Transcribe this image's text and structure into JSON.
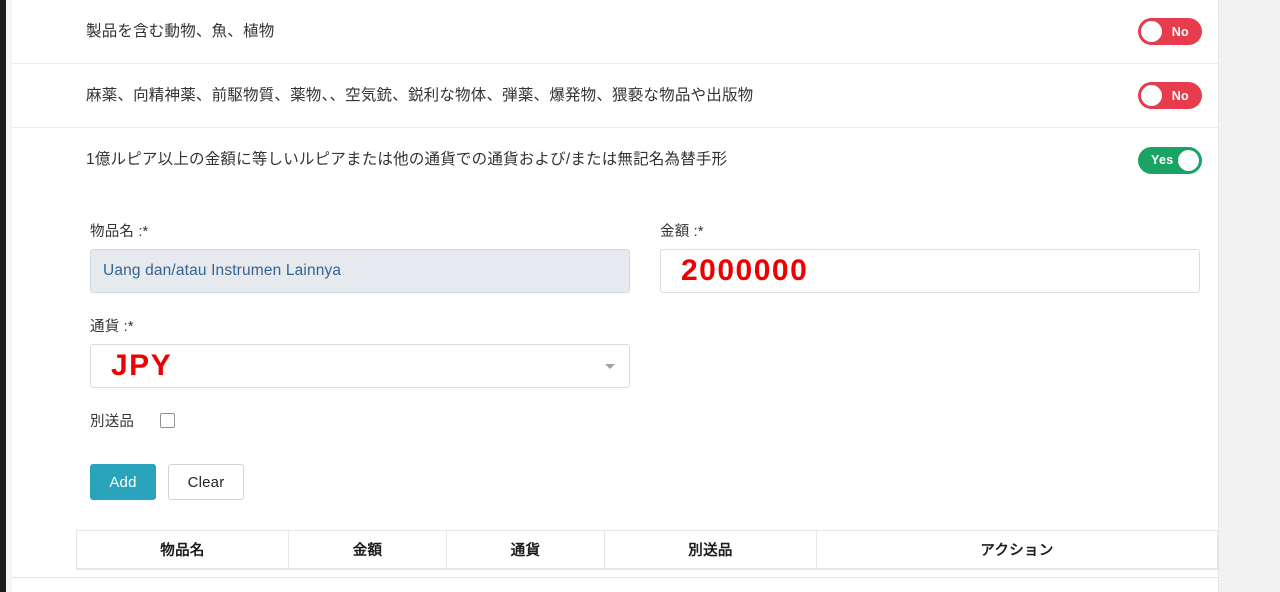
{
  "questions": [
    {
      "text": "製品を含む動物、魚、植物",
      "answer": "No",
      "state": "off"
    },
    {
      "text": "麻薬、向精神薬、前駆物質、薬物、、空気銃、鋭利な物体、弾薬、爆発物、猥褻な物品や出版物",
      "answer": "No",
      "state": "off"
    },
    {
      "text": "1億ルピア以上の金額に等しいルピアまたは他の通貨での通貨および/または無記名為替手形",
      "answer": "Yes",
      "state": "on"
    }
  ],
  "form": {
    "item_name": {
      "label": "物品名 :*",
      "value": "Uang dan/atau Instrumen Lainnya",
      "placeholder": "Uang dan/atau Instrumen Lainnya"
    },
    "amount": {
      "label": "金額 :*",
      "value": "2000000",
      "placeholder": ""
    },
    "currency": {
      "label": "通貨 :*",
      "value": "JPY",
      "options": [
        "JPY"
      ]
    },
    "separate_shipment": {
      "label": "別送品",
      "checked": false
    },
    "buttons": {
      "add": "Add",
      "clear": "Clear"
    }
  },
  "items_table": {
    "columns": [
      "物品名",
      "金額",
      "通貨",
      "別送品",
      "アクション"
    ],
    "rows": []
  },
  "colors": {
    "toggle_off": "#e73c4e",
    "toggle_on": "#19a463",
    "primary_button": "#2aa3bd",
    "value_red": "#ee0000",
    "disabled_text": "#37648f"
  }
}
